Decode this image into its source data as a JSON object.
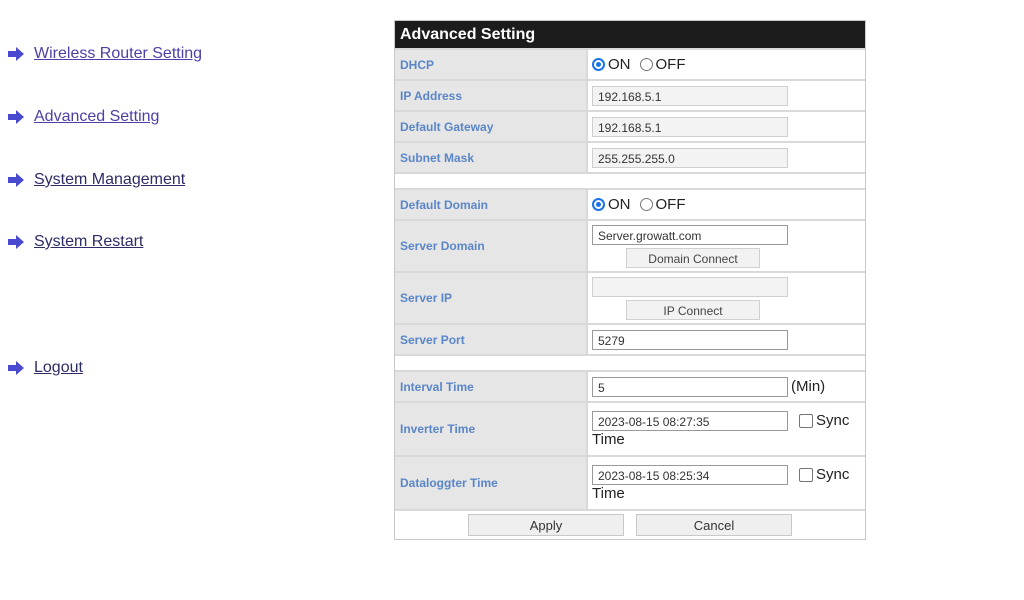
{
  "nav": {
    "items": [
      {
        "label": "Wireless Router Setting",
        "icon": "arrow-right-icon"
      },
      {
        "label": "Advanced Setting",
        "icon": "arrow-right-icon"
      },
      {
        "label": "System Management",
        "icon": "arrow-right-icon"
      },
      {
        "label": "System Restart",
        "icon": "arrow-right-icon"
      },
      {
        "label": "Logout",
        "icon": "arrow-right-icon"
      }
    ]
  },
  "panel": {
    "title": "Advanced Setting",
    "dhcp": {
      "label": "DHCP",
      "on": "ON",
      "off": "OFF",
      "selected": "ON"
    },
    "ip_address": {
      "label": "IP Address",
      "value": "192.168.5.1"
    },
    "gateway": {
      "label": "Default Gateway",
      "value": "192.168.5.1"
    },
    "subnet": {
      "label": "Subnet Mask",
      "value": "255.255.255.0"
    },
    "default_domain": {
      "label": "Default Domain",
      "on": "ON",
      "off": "OFF",
      "selected": "ON"
    },
    "server_domain": {
      "label": "Server Domain",
      "value": "Server.growatt.com",
      "button": "Domain Connect"
    },
    "server_ip": {
      "label": "Server IP",
      "value": "",
      "button": "IP Connect"
    },
    "server_port": {
      "label": "Server Port",
      "value": "5279"
    },
    "interval": {
      "label": "Interval Time",
      "value": "5",
      "unit": "(Min)"
    },
    "inverter_time": {
      "label": "Inverter Time",
      "value": "2023-08-15 08:27:35",
      "sync": "Sync",
      "sync_tail": "Time"
    },
    "datalogger_time": {
      "label": "Dataloggter Time",
      "value": "2023-08-15 08:25:34",
      "sync": "Sync",
      "sync_tail": "Time"
    },
    "apply": "Apply",
    "cancel": "Cancel"
  },
  "colors": {
    "header_bg": "#1c1c1c",
    "label_text": "#5a86c8",
    "link": "#4b3fa8",
    "radio_accent": "#1a73e8"
  }
}
